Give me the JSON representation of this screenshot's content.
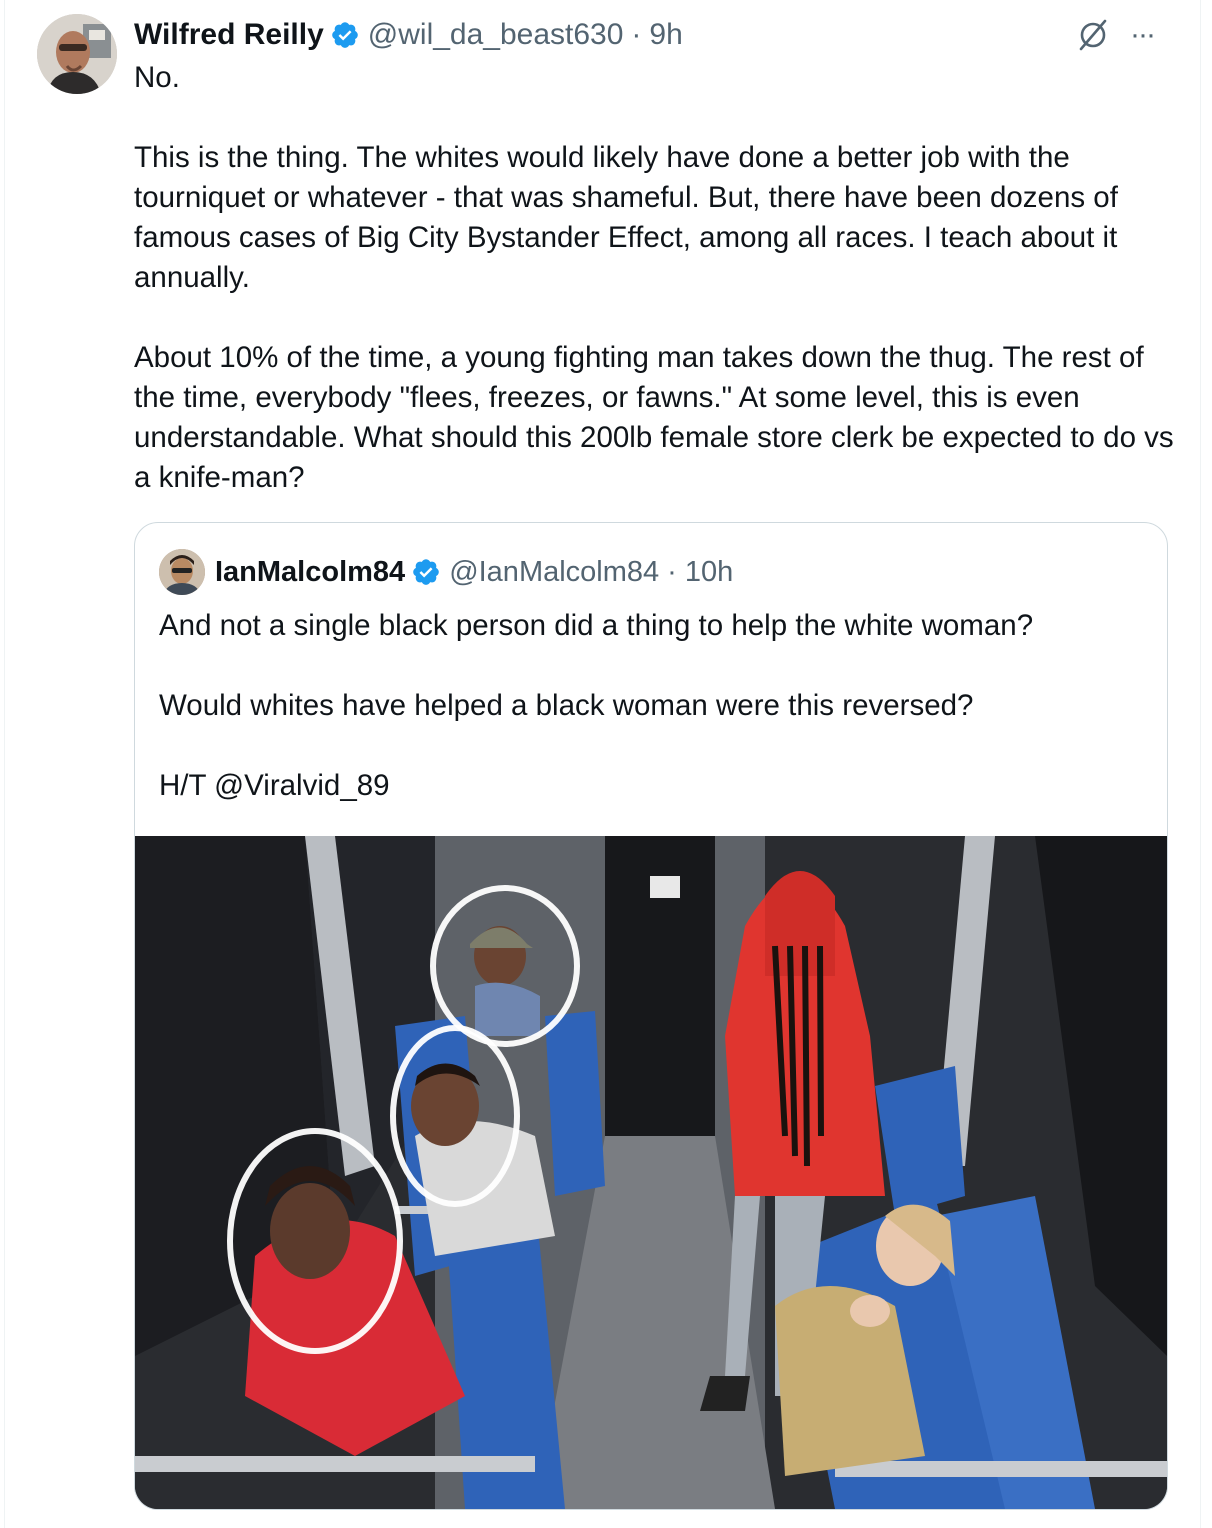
{
  "tweet": {
    "author_name": "Wilfred Reilly",
    "author_handle": "@wil_da_beast630",
    "separator": "·",
    "time": "9h",
    "paragraphs": [
      "No.",
      "This is the thing. The whites would likely have done a better job with the tourniquet or whatever - that was shameful. But, there have been dozens of famous cases of Big City Bystander Effect, among all races. I teach about it annually.",
      "About 10% of the time, a young fighting man takes down the thug. The rest of the time, everybody \"flees, freezes, or fawns.\" At some level, this is even understandable. What should this 200lb female store clerk be expected to do vs a knife-man?"
    ],
    "icons": {
      "verified": "verified-badge-icon",
      "grok": "grok-icon",
      "more": "more-icon"
    },
    "more_label": "···"
  },
  "quoted_tweet": {
    "author_name": "IanMalcolm84",
    "author_handle": "@IanMalcolm84",
    "separator": "·",
    "time": "10h",
    "paragraphs": [
      "And not a single black person did a thing to help the white woman?",
      "Would whites have helped a black woman were this reversed?",
      "H/T @Viralvid_89"
    ]
  },
  "colors": {
    "text": "#0f1419",
    "secondary": "#536471",
    "verified": "#1d9bf0",
    "border": "#cfd9de",
    "hoodie": "#e0352f",
    "seat_blue": "#2f63b8"
  }
}
